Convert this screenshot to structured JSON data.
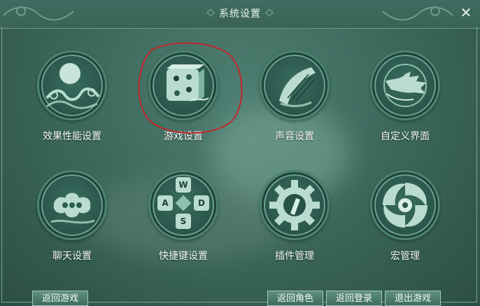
{
  "window": {
    "title": "系统设置",
    "close_glyph": "✕"
  },
  "tiles": [
    {
      "label": "效果性能设置",
      "icon": "moon-waves-icon"
    },
    {
      "label": "游戏设置",
      "icon": "dice-icon"
    },
    {
      "label": "声音设置",
      "icon": "harp-icon"
    },
    {
      "label": "自定义界面",
      "icon": "hand-icon"
    },
    {
      "label": "聊天设置",
      "icon": "cloud-icon"
    },
    {
      "label": "快捷键设置",
      "icon": "wasd-keys-icon"
    },
    {
      "label": "插件管理",
      "icon": "gear-icon"
    },
    {
      "label": "宏管理",
      "icon": "swirl-icon"
    }
  ],
  "keys": {
    "up": "W",
    "left": "A",
    "right": "D",
    "down": "S"
  },
  "buttons": {
    "back_to_game": "返回游戏",
    "back_to_character": "返回角色",
    "back_to_login": "返回登录",
    "exit_game": "退出游戏"
  },
  "annotation": {
    "color": "#c0282b",
    "target": "游戏设置"
  }
}
